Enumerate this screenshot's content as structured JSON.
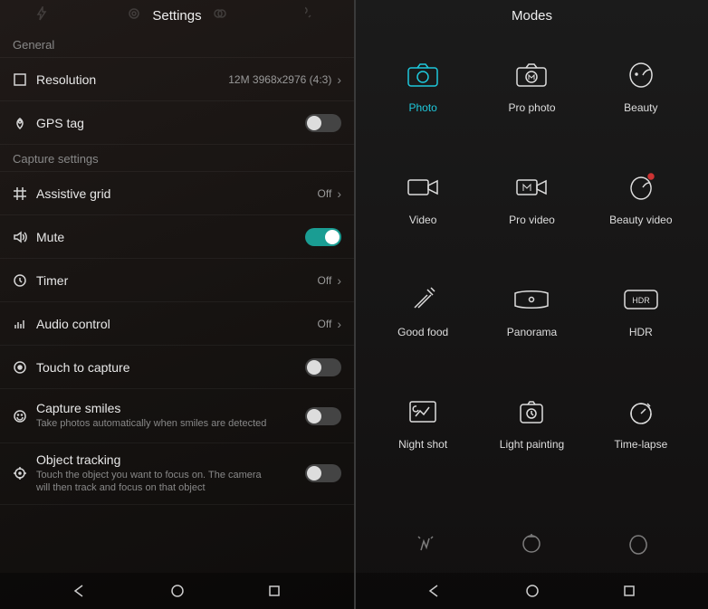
{
  "left": {
    "header": "Settings",
    "sections": {
      "general_label": "General",
      "capture_label": "Capture settings"
    },
    "rows": {
      "resolution": {
        "title": "Resolution",
        "value": "12M 3968x2976 (4:3)"
      },
      "gps": {
        "title": "GPS tag"
      },
      "grid": {
        "title": "Assistive grid",
        "value": "Off"
      },
      "mute": {
        "title": "Mute"
      },
      "timer": {
        "title": "Timer",
        "value": "Off"
      },
      "audio": {
        "title": "Audio control",
        "value": "Off"
      },
      "touch": {
        "title": "Touch to capture"
      },
      "smiles": {
        "title": "Capture smiles",
        "subtitle": "Take photos automatically when smiles are detected"
      },
      "track": {
        "title": "Object tracking",
        "subtitle": "Touch the object you want to focus on. The camera will then track and focus on that object"
      }
    }
  },
  "right": {
    "header": "Modes",
    "modes": {
      "photo": "Photo",
      "pro_photo": "Pro photo",
      "beauty": "Beauty",
      "video": "Video",
      "pro_video": "Pro video",
      "beauty_video": "Beauty video",
      "good_food": "Good food",
      "panorama": "Panorama",
      "hdr": "HDR",
      "night_shot": "Night shot",
      "light_painting": "Light painting",
      "time_lapse": "Time-lapse"
    }
  }
}
